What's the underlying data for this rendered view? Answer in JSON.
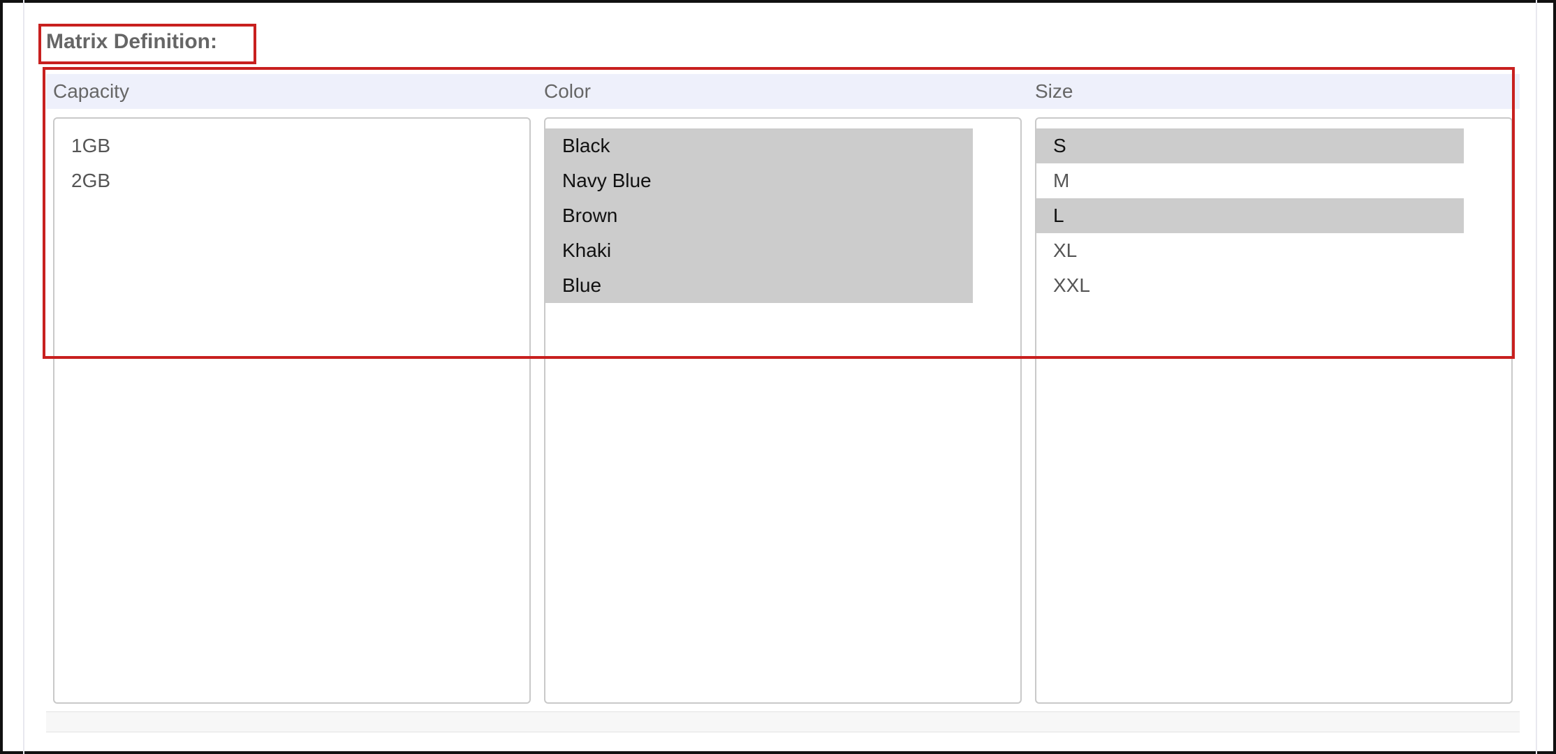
{
  "section": {
    "title": "Matrix Definition:"
  },
  "columns": [
    {
      "label": "Capacity",
      "options": [
        {
          "text": "1GB",
          "selected": false
        },
        {
          "text": "2GB",
          "selected": false
        }
      ]
    },
    {
      "label": "Color",
      "options": [
        {
          "text": "Black",
          "selected": true
        },
        {
          "text": "Navy Blue",
          "selected": true
        },
        {
          "text": "Brown",
          "selected": true
        },
        {
          "text": "Khaki",
          "selected": true
        },
        {
          "text": "Blue",
          "selected": true
        }
      ]
    },
    {
      "label": "Size",
      "options": [
        {
          "text": "S",
          "selected": true
        },
        {
          "text": "M",
          "selected": false
        },
        {
          "text": "L",
          "selected": true
        },
        {
          "text": "XL",
          "selected": false
        },
        {
          "text": "XXL",
          "selected": false
        }
      ]
    }
  ],
  "colors": {
    "highlight_border": "#c8201f",
    "header_band": "#eef0fb",
    "selected_option": "#cccccc"
  }
}
